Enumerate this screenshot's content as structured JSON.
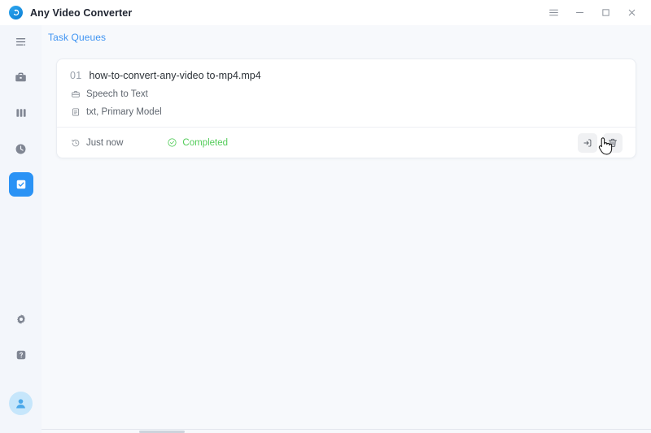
{
  "window": {
    "title": "Any Video Converter",
    "logo_icon": "app-logo-icon",
    "controls": [
      {
        "name": "menu-button",
        "icon": "hamburger-icon",
        "label": "Menu"
      },
      {
        "name": "minimize-button",
        "icon": "minimize-icon",
        "label": "Minimize"
      },
      {
        "name": "maximize-button",
        "icon": "maximize-icon",
        "label": "Maximize"
      },
      {
        "name": "close-button",
        "icon": "close-icon",
        "label": "Close"
      }
    ]
  },
  "sidebar": {
    "items": [
      {
        "name": "sidebar-collapse",
        "icon": "collapse-menu-icon",
        "label": "Collapse",
        "active": false
      },
      {
        "name": "sidebar-item-toolbox",
        "icon": "toolbox-icon",
        "label": "Toolbox",
        "active": false
      },
      {
        "name": "sidebar-item-library",
        "icon": "library-icon",
        "label": "Library",
        "active": false
      },
      {
        "name": "sidebar-item-history",
        "icon": "clock-icon",
        "label": "History",
        "active": false
      },
      {
        "name": "sidebar-item-tasks",
        "icon": "task-checklist-icon",
        "label": "Task Queues",
        "active": true
      }
    ],
    "bottom_items": [
      {
        "name": "sidebar-item-settings",
        "icon": "gear-icon",
        "label": "Settings"
      },
      {
        "name": "sidebar-item-help",
        "icon": "help-icon",
        "label": "Help"
      }
    ],
    "avatar": {
      "name": "avatar",
      "icon": "user-icon",
      "label": "Account"
    }
  },
  "header": {
    "tab_label": "Task Queues"
  },
  "task": {
    "index": "01",
    "filename": "how-to-convert-any-video to-mp4.mp4",
    "meta": [
      {
        "icon": "toolbox-icon",
        "text": "Speech to Text"
      },
      {
        "icon": "document-icon",
        "text": "txt, Primary Model"
      }
    ],
    "time_icon": "history-clock-icon",
    "time": "Just now",
    "status_icon": "check-circle-icon",
    "status": "Completed",
    "actions": [
      {
        "name": "open-output-button",
        "icon": "export-icon",
        "label": "Open output"
      },
      {
        "name": "delete-task-button",
        "icon": "trash-icon",
        "label": "Delete"
      }
    ]
  },
  "colors": {
    "accent": "#2b93f5",
    "link": "#3f94f2",
    "success": "#54cc5a",
    "sidebar_bg": "#f3f6fb",
    "content_bg": "#f7f9fc",
    "card_bg": "#ffffff"
  }
}
